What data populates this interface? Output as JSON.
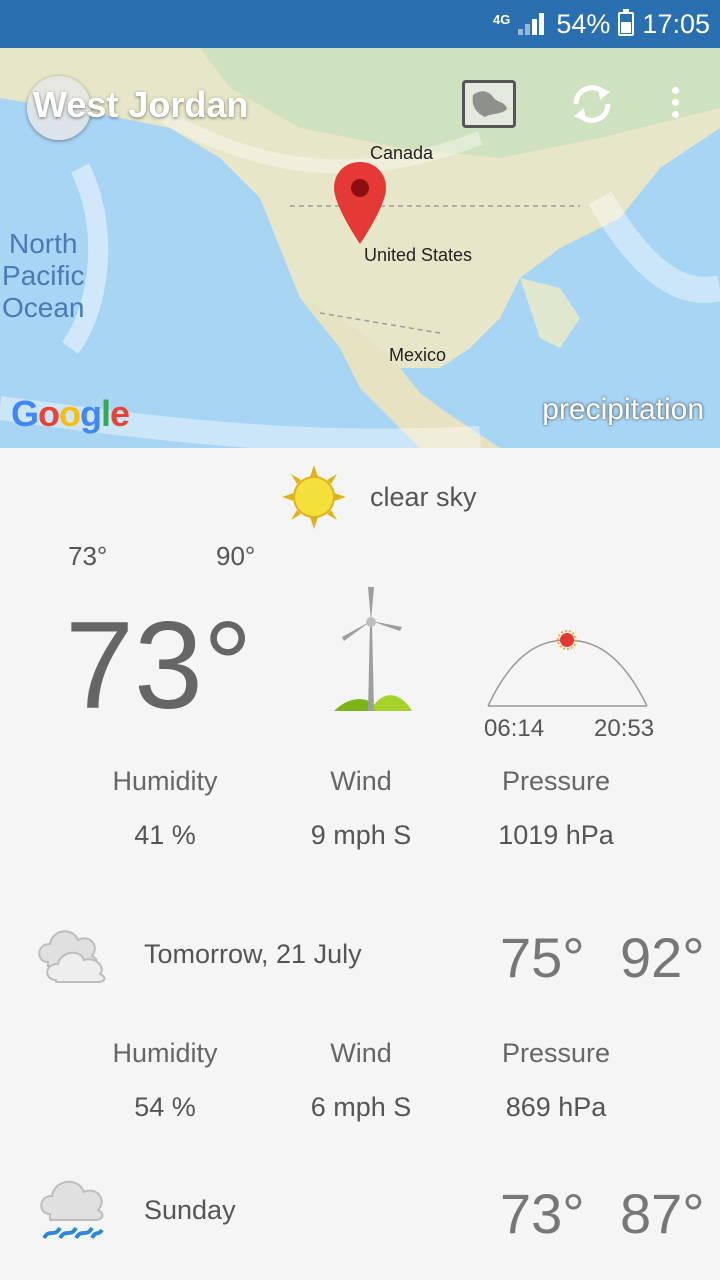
{
  "status_bar": {
    "network": "4G",
    "battery": "54%",
    "time": "17:05",
    "signal_icon": "signal-icon",
    "battery_icon": "battery-charging-icon"
  },
  "header": {
    "city": "West Jordan",
    "map_button_icon": "map-icon",
    "refresh_icon": "refresh-icon",
    "menu_icon": "more-vert-icon"
  },
  "map": {
    "labels": {
      "canada": "Canada",
      "us": "United States",
      "mexico": "Mexico",
      "ocean_1": "North",
      "ocean_2": "Pacific",
      "ocean_3": "Ocean"
    },
    "google": "Google",
    "layer": "precipitation"
  },
  "today": {
    "condition": "clear sky",
    "low": "73°",
    "high": "90°",
    "current": "73°",
    "sunrise": "06:14",
    "sunset": "20:53",
    "humidity_label": "Humidity",
    "humidity": "41 %",
    "wind_label": "Wind",
    "wind": "9 mph S",
    "pressure_label": "Pressure",
    "pressure": "1019 hPa"
  },
  "forecast": [
    {
      "day": "Tomorrow, 21 July",
      "low": "75°",
      "high": "92°",
      "icon": "cloudy-icon",
      "humidity_label": "Humidity",
      "humidity": "54 %",
      "wind_label": "Wind",
      "wind": "6 mph S",
      "pressure_label": "Pressure",
      "pressure": "869 hPa"
    },
    {
      "day": "Sunday",
      "low": "73°",
      "high": "87°",
      "icon": "rain-icon"
    }
  ],
  "colors": {
    "status_bar": "#2a6fb0",
    "pin": "#e53935",
    "sun": "#f4d03f"
  }
}
